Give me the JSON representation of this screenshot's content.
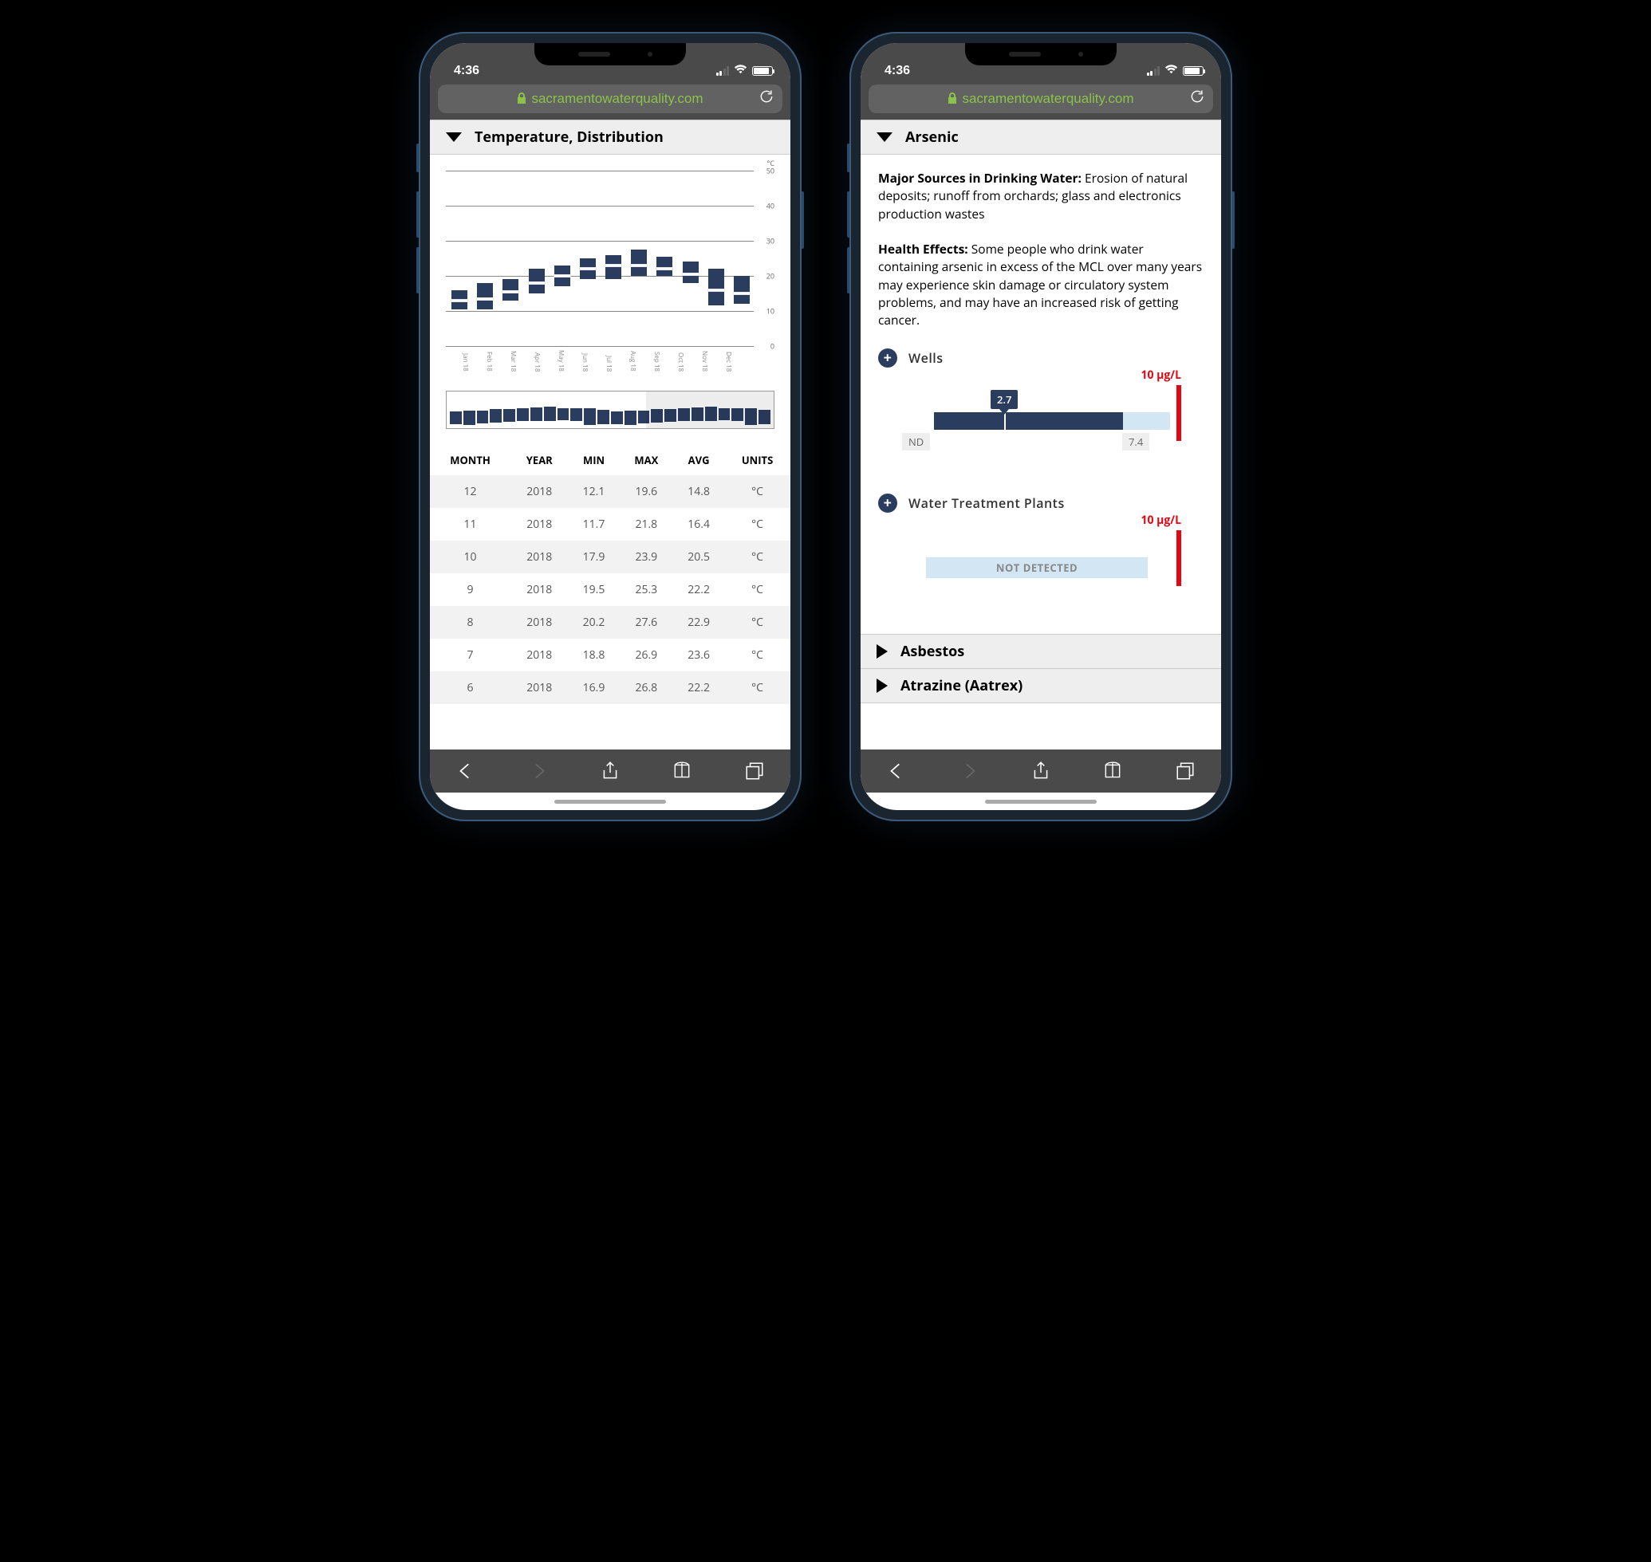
{
  "status": {
    "time": "4:36",
    "signal_active": 2,
    "battery_pct": 85
  },
  "browser": {
    "url": "sacramentowaterquality.com"
  },
  "left": {
    "section_title": "Temperature, Distribution",
    "chart_data": {
      "type": "bar",
      "ylabel": "°C",
      "ylim": [
        0,
        50
      ],
      "categories": [
        "Jan 18",
        "Feb 18",
        "Mar 18",
        "Apr 18",
        "May 18",
        "Jun 18",
        "Jul 18",
        "Aug 18",
        "Sep 18",
        "Oct 18",
        "Nov 18",
        "Dec 18"
      ],
      "series": [
        {
          "name": "min",
          "values": [
            10.5,
            10.5,
            13,
            15,
            17,
            19,
            19,
            20,
            20,
            18,
            11.5,
            12
          ]
        },
        {
          "name": "median",
          "values": [
            13,
            13.5,
            15.5,
            18,
            20,
            22,
            23,
            23,
            22,
            20.5,
            16,
            15
          ]
        },
        {
          "name": "max",
          "values": [
            16,
            18,
            19,
            22,
            23,
            25,
            26,
            27.5,
            25.5,
            24,
            22,
            20
          ]
        }
      ]
    },
    "table": {
      "headers": [
        "MONTH",
        "YEAR",
        "MIN",
        "MAX",
        "AVG",
        "UNITS"
      ],
      "rows": [
        {
          "month": "12",
          "year": "2018",
          "min": "12.1",
          "max": "19.6",
          "avg": "14.8",
          "units": "°C"
        },
        {
          "month": "11",
          "year": "2018",
          "min": "11.7",
          "max": "21.8",
          "avg": "16.4",
          "units": "°C"
        },
        {
          "month": "10",
          "year": "2018",
          "min": "17.9",
          "max": "23.9",
          "avg": "20.5",
          "units": "°C"
        },
        {
          "month": "9",
          "year": "2018",
          "min": "19.5",
          "max": "25.3",
          "avg": "22.2",
          "units": "°C"
        },
        {
          "month": "8",
          "year": "2018",
          "min": "20.2",
          "max": "27.6",
          "avg": "22.9",
          "units": "°C"
        },
        {
          "month": "7",
          "year": "2018",
          "min": "18.8",
          "max": "26.9",
          "avg": "23.6",
          "units": "°C"
        },
        {
          "month": "6",
          "year": "2018",
          "min": "16.9",
          "max": "26.8",
          "avg": "22.2",
          "units": "°C"
        }
      ]
    }
  },
  "right": {
    "section_title": "Arsenic",
    "sources_label": "Major Sources in Drinking Water:",
    "sources_text": " Erosion of natural deposits; runoff from orchards; glass and electronics production wastes",
    "health_label": "Health Effects:",
    "health_text": " Some people who drink water containing arsenic in excess of the MCL over many years may experience skin damage or circulatory system problems, and may have an increased risk of getting cancer.",
    "wells": {
      "title": "Wells",
      "limit_label": "10 µg/L",
      "nd_label": "ND",
      "median_value": "2.7",
      "max_value": "7.4",
      "chart_data": {
        "type": "bar",
        "limit": 10,
        "min": 0,
        "median": 2.7,
        "max": 7.4,
        "nd": true
      }
    },
    "wtp": {
      "title": "Water Treatment Plants",
      "limit_label": "10 µg/L",
      "not_detected": "NOT DETECTED",
      "chart_data": {
        "type": "bar",
        "limit": 10,
        "detected": false
      }
    },
    "asbestos_title": "Asbestos",
    "atrazine_title": "Atrazine (Aatrex)"
  }
}
